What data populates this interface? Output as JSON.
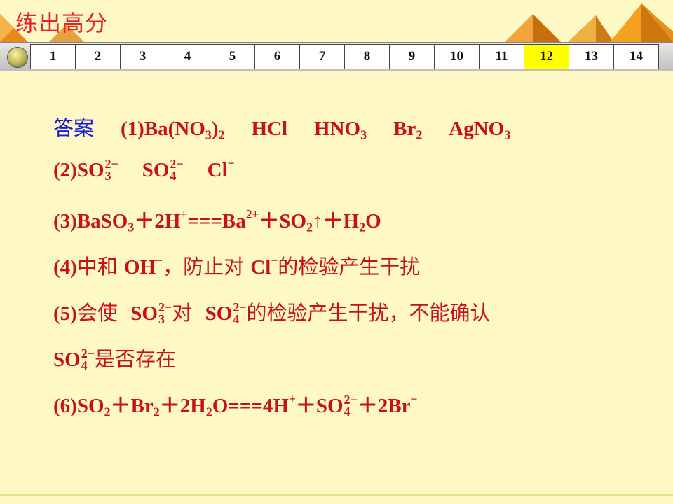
{
  "header": {
    "title": "练出高分"
  },
  "nav": {
    "pages": [
      "1",
      "2",
      "3",
      "4",
      "5",
      "6",
      "7",
      "8",
      "9",
      "10",
      "11",
      "12",
      "13",
      "14"
    ],
    "active_page": "12"
  },
  "answer": {
    "label": "答案",
    "l1": {
      "p1": "(1)Ba(NO",
      "p1sub": "3",
      "p1b": ")",
      "p1bsub": "2",
      "hcl": "HCl",
      "hno": "HNO",
      "hnosub": "3",
      "br": "Br",
      "brsub": "2",
      "ag": "AgNO",
      "agsub": "3"
    },
    "l2": {
      "pre": "(2)SO",
      "sup1": "2−",
      "sub1": "3",
      "so4": "SO",
      "sup2": "2−",
      "sub2": "4",
      "cl": "Cl",
      "clsup": "−"
    },
    "l3": {
      "a": "(3)BaSO",
      "asub": "3",
      "b": "＋2H",
      "bsup": "+",
      "c": "===Ba",
      "csup": "2+",
      "d": "＋SO",
      "dsub": "2",
      "e": "↑＋H",
      "esub": "2",
      "f": "O"
    },
    "l4": {
      "a": "(4)",
      "b": "中和 ",
      "c": "OH",
      "csup": "−",
      "d": "，防止对 ",
      "e": "Cl",
      "esup": "−",
      "f": "的检验产生干扰"
    },
    "l5": {
      "a": "(5)",
      "b": "会使  ",
      "c": "SO",
      "csup": "2−",
      "csub": "3",
      "d": "对  ",
      "e": "SO",
      "esup": "2−",
      "esub": "4",
      "f": "的检验产生干扰，不能确认"
    },
    "l6": {
      "a": "SO",
      "asup": "2−",
      "asub": "4",
      "b": "是否存在"
    },
    "l7": {
      "a": "(6)SO",
      "asub": "2",
      "b": "＋Br",
      "bsub": "2",
      "c": "＋2H",
      "csub": "2",
      "d": "O===4H",
      "dsup": "+",
      "e": "＋SO",
      "esup": "2−",
      "esub": "4",
      "f": "＋2Br",
      "fsup": "−"
    }
  },
  "colors": {
    "background": "#fdf8c4",
    "answer_text": "#c8101c",
    "answer_label": "#1a1adc",
    "active_tab": "#ffff00"
  }
}
